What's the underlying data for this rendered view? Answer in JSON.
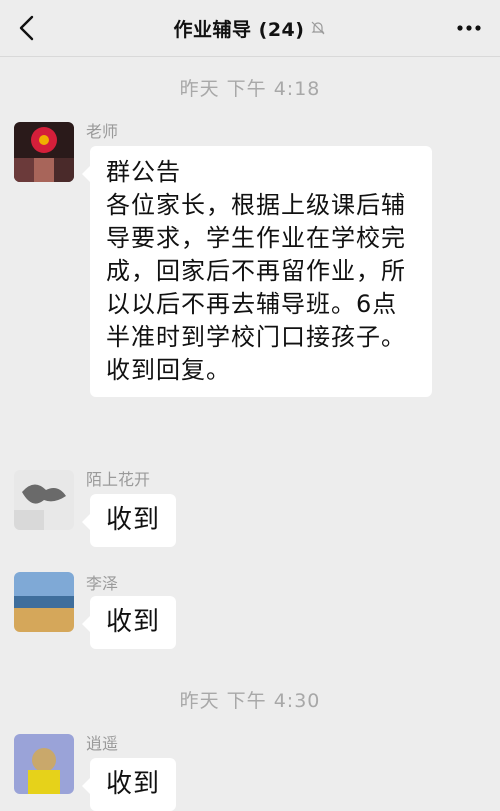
{
  "header": {
    "title": "作业辅导 (24)",
    "back_icon": "chevron-left-icon",
    "mute_icon": "bell-off-icon",
    "more_icon": "more-dots-icon"
  },
  "timestamps": [
    "昨天 下午 4:18",
    "昨天 下午 4:30"
  ],
  "messages": [
    {
      "sender": "老师",
      "title": "群公告",
      "text": "各位家长，根据上级课后辅导要求，学生作业在学校完成，回家后不再留作业，所以以后不再去辅导班。6点半准时到学校门口接孩子。收到回复。"
    },
    {
      "sender": "陌上花开",
      "text": "收到"
    },
    {
      "sender": "李泽",
      "text": "收到"
    },
    {
      "sender": "逍遥",
      "text": "收到"
    }
  ],
  "colors": {
    "background": "#ededed",
    "bubble": "#ffffff",
    "text": "#111111",
    "meta": "#a8a8a8"
  }
}
